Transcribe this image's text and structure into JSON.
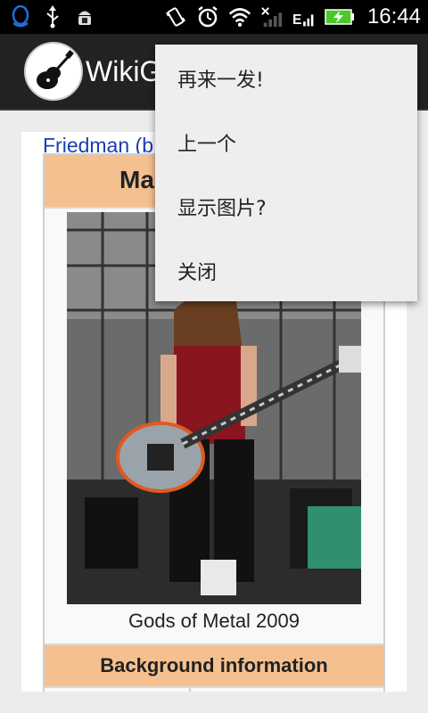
{
  "status_bar": {
    "time": "16:44",
    "icons": [
      "qq-icon",
      "usb-icon",
      "android-debug-icon",
      "vibrate-icon",
      "alarm-icon",
      "wifi-icon",
      "no-signal-icon",
      "edge-signal-icon",
      "battery-charging-icon"
    ]
  },
  "action_bar": {
    "title": "WikiG",
    "logo": "guitar-icon"
  },
  "page": {
    "link_text": "Friedman (b",
    "infobox_title": "Ma",
    "photo_caption": "Gods of Metal 2009",
    "background_header": "Background information"
  },
  "menu": {
    "items": [
      {
        "label": "再来一发!"
      },
      {
        "label": "上一个"
      },
      {
        "label": "显示图片?"
      },
      {
        "label": "关闭"
      }
    ]
  },
  "colors": {
    "infobox_header": "#f5c08f",
    "link": "#1a3fb0",
    "status_accent": "#1e6fd9",
    "battery": "#4cc82c"
  }
}
